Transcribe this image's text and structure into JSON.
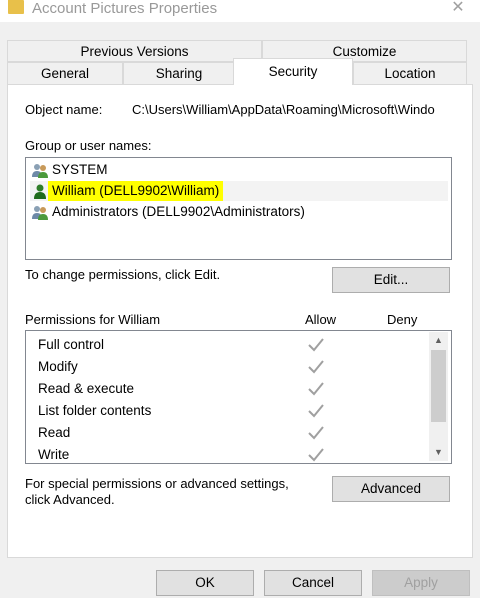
{
  "window": {
    "title": "Account Pictures Properties",
    "close_glyph": "✕"
  },
  "tabs": {
    "row_back": [
      "Previous Versions",
      "Customize"
    ],
    "row_front": [
      "General",
      "Sharing",
      "Security",
      "Location"
    ],
    "selected": "Security"
  },
  "security": {
    "object_name_label": "Object name:",
    "object_name_value": "C:\\Users\\William\\AppData\\Roaming\\Microsoft\\Windo",
    "group_label": "Group or user names:",
    "users": [
      {
        "name": "SYSTEM",
        "icon": "users-group-icon",
        "selected": false
      },
      {
        "name": "William (DELL9902\\William)",
        "icon": "user-icon",
        "selected": true,
        "highlight_color": "#ffff00"
      },
      {
        "name": "Administrators (DELL9902\\Administrators)",
        "icon": "users-group-icon",
        "selected": false
      }
    ],
    "change_text": "To change permissions, click Edit.",
    "edit_label": "Edit...",
    "permissions_for": "Permissions for William",
    "allow_header": "Allow",
    "deny_header": "Deny",
    "permissions": [
      {
        "name": "Full control",
        "allow": true,
        "deny": false
      },
      {
        "name": "Modify",
        "allow": true,
        "deny": false
      },
      {
        "name": "Read & execute",
        "allow": true,
        "deny": false
      },
      {
        "name": "List folder contents",
        "allow": true,
        "deny": false
      },
      {
        "name": "Read",
        "allow": true,
        "deny": false
      },
      {
        "name": "Write",
        "allow": true,
        "deny": false
      }
    ],
    "advanced_text_line1": "For special permissions or advanced settings,",
    "advanced_text_line2": "click Advanced.",
    "advanced_label": "Advanced"
  },
  "buttons": {
    "ok": "OK",
    "cancel": "Cancel",
    "apply": "Apply"
  },
  "colors": {
    "highlight": "#ffff00",
    "check": "#a0a0a0"
  }
}
